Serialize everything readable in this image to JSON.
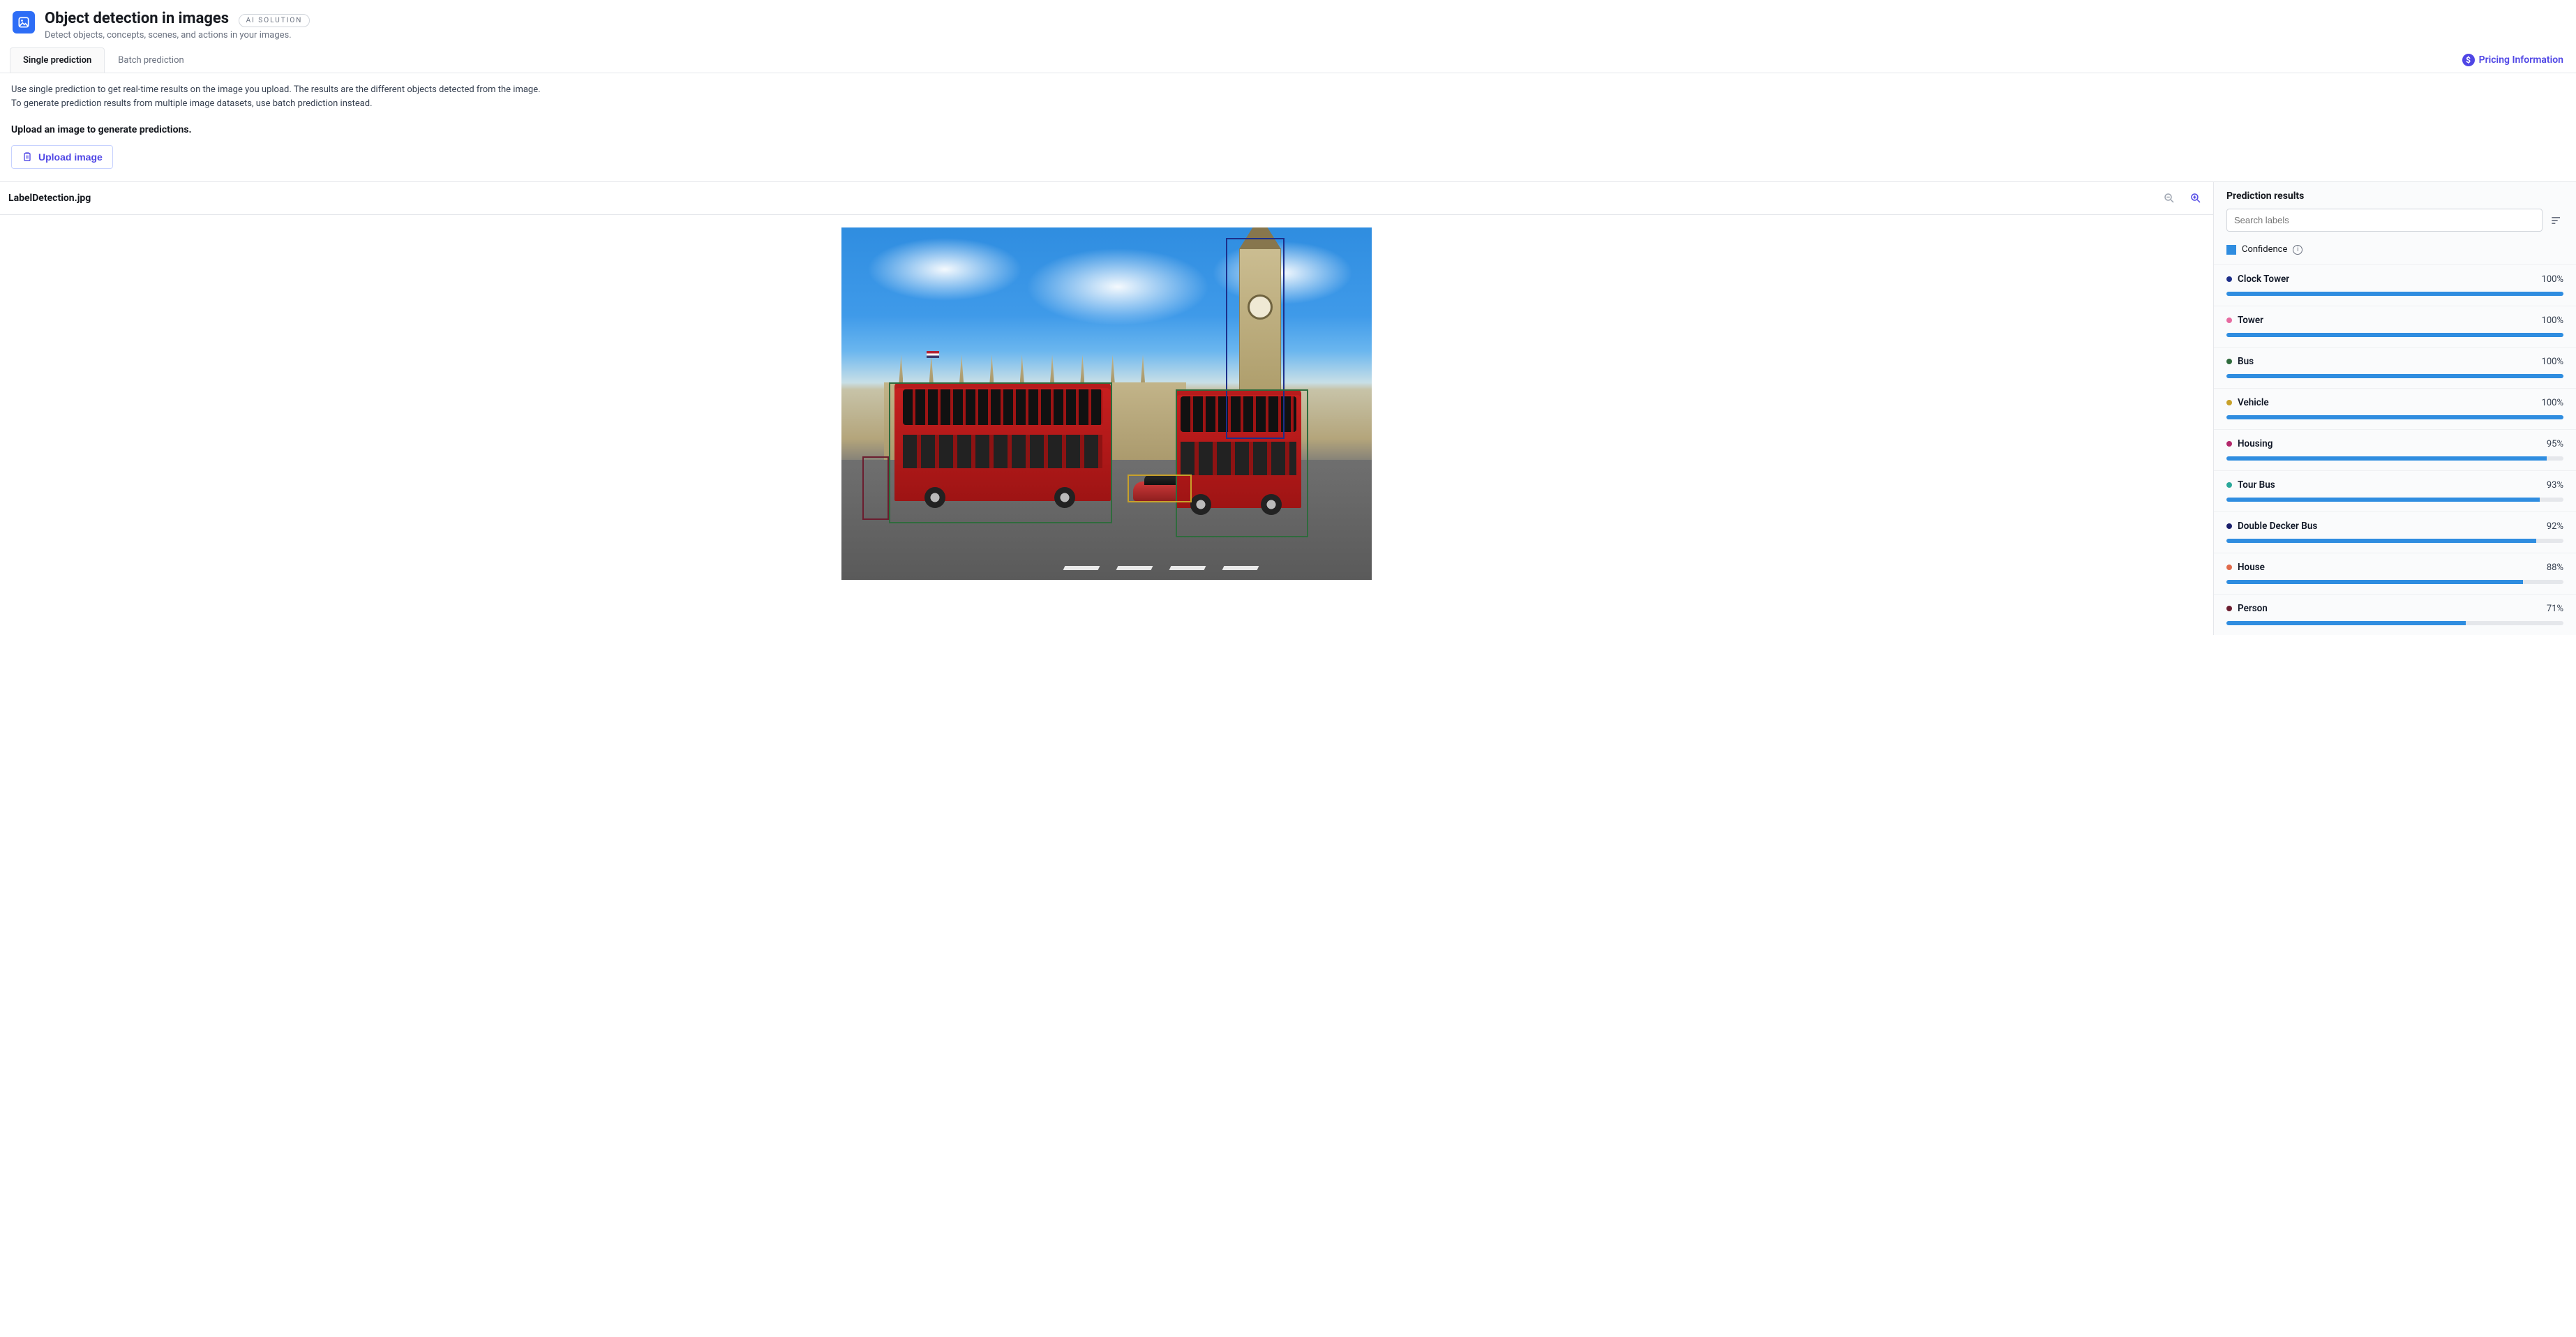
{
  "header": {
    "title": "Object detection in images",
    "badge": "AI SOLUTION",
    "subtitle": "Detect objects, concepts, scenes, and actions in your images."
  },
  "tabs": {
    "single": "Single prediction",
    "batch": "Batch prediction"
  },
  "pricing_link": "Pricing Information",
  "intro": {
    "line1": "Use single prediction to get real-time results on the image you upload. The results are the different objects detected from the image.",
    "line2": "To generate prediction results from multiple image datasets, use batch prediction instead."
  },
  "upload": {
    "title": "Upload an image to generate predictions.",
    "button": "Upload image"
  },
  "image": {
    "filename": "LabelDetection.jpg"
  },
  "results": {
    "title": "Prediction results",
    "search_placeholder": "Search labels",
    "legend": "Confidence",
    "items": [
      {
        "label": "Clock Tower",
        "pct": 100,
        "pct_text": "100%",
        "color": "#1d2f8a"
      },
      {
        "label": "Tower",
        "pct": 100,
        "pct_text": "100%",
        "color": "#e76aa0"
      },
      {
        "label": "Bus",
        "pct": 100,
        "pct_text": "100%",
        "color": "#2f6b3d"
      },
      {
        "label": "Vehicle",
        "pct": 100,
        "pct_text": "100%",
        "color": "#c8a12a"
      },
      {
        "label": "Housing",
        "pct": 95,
        "pct_text": "95%",
        "color": "#b3286b"
      },
      {
        "label": "Tour Bus",
        "pct": 93,
        "pct_text": "93%",
        "color": "#2aa89a"
      },
      {
        "label": "Double Decker Bus",
        "pct": 92,
        "pct_text": "92%",
        "color": "#1a1f6b"
      },
      {
        "label": "House",
        "pct": 88,
        "pct_text": "88%",
        "color": "#e06a4a"
      },
      {
        "label": "Person",
        "pct": 71,
        "pct_text": "71%",
        "color": "#6b1d2f"
      }
    ]
  },
  "colors": {
    "accent": "#4f46e5",
    "bar": "#2f8de0"
  }
}
